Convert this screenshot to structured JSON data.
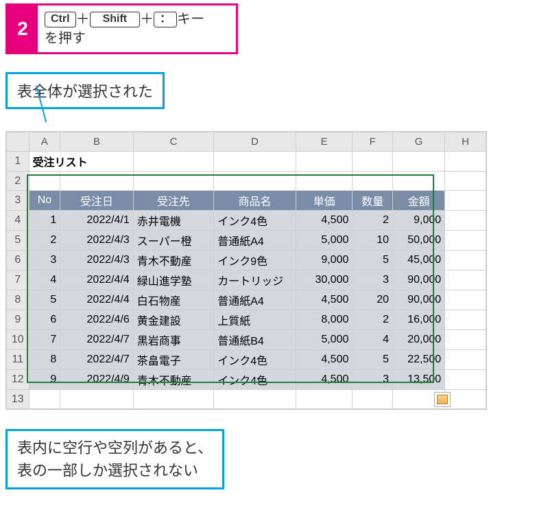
{
  "step": {
    "num": "2",
    "key1": "Ctrl",
    "plus1": "＋",
    "key2": "Shift",
    "plus2": "＋",
    "key3": "：",
    "suffix": "キー",
    "line2": "を押す"
  },
  "callout1": "表全体が選択された",
  "callout2_l1": "表内に空行や空列があると、",
  "callout2_l2": "表の一部しか選択されない",
  "cols": {
    "A": "A",
    "B": "B",
    "C": "C",
    "D": "D",
    "E": "E",
    "F": "F",
    "G": "G",
    "H": "H"
  },
  "rows": {
    "1": "1",
    "2": "2",
    "3": "3",
    "4": "4",
    "5": "5",
    "6": "6",
    "7": "7",
    "8": "8",
    "9": "9",
    "10": "10",
    "11": "11",
    "12": "12",
    "13": "13"
  },
  "title": "受注リスト",
  "headers": {
    "no": "No",
    "date": "受注日",
    "client": "受注先",
    "product": "商品名",
    "price": "単価",
    "qty": "数量",
    "amount": "金額"
  },
  "data": [
    {
      "no": "1",
      "date": "2022/4/1",
      "client": "赤井電機",
      "product": "インク4色",
      "price": "4,500",
      "qty": "2",
      "amount": "9,000"
    },
    {
      "no": "2",
      "date": "2022/4/3",
      "client": "スーパー橙",
      "product": "普通紙A4",
      "price": "5,000",
      "qty": "10",
      "amount": "50,000"
    },
    {
      "no": "3",
      "date": "2022/4/3",
      "client": "青木不動産",
      "product": "インク9色",
      "price": "9,000",
      "qty": "5",
      "amount": "45,000"
    },
    {
      "no": "4",
      "date": "2022/4/4",
      "client": "緑山進学塾",
      "product": "カートリッジ",
      "price": "30,000",
      "qty": "3",
      "amount": "90,000"
    },
    {
      "no": "5",
      "date": "2022/4/4",
      "client": "白石物産",
      "product": "普通紙A4",
      "price": "4,500",
      "qty": "20",
      "amount": "90,000"
    },
    {
      "no": "6",
      "date": "2022/4/6",
      "client": "黄金建設",
      "product": "上質紙",
      "price": "8,000",
      "qty": "2",
      "amount": "16,000"
    },
    {
      "no": "7",
      "date": "2022/4/7",
      "client": "黒岩商事",
      "product": "普通紙B4",
      "price": "5,000",
      "qty": "4",
      "amount": "20,000"
    },
    {
      "no": "8",
      "date": "2022/4/7",
      "client": "茶畠電子",
      "product": "インク4色",
      "price": "4,500",
      "qty": "5",
      "amount": "22,500"
    },
    {
      "no": "9",
      "date": "2022/4/9",
      "client": "青木不動産",
      "product": "インク4色",
      "price": "4,500",
      "qty": "3",
      "amount": "13,500"
    }
  ],
  "chart_data": {
    "type": "table",
    "title": "受注リスト",
    "columns": [
      "No",
      "受注日",
      "受注先",
      "商品名",
      "単価",
      "数量",
      "金額"
    ],
    "rows": [
      [
        1,
        "2022/4/1",
        "赤井電機",
        "インク4色",
        4500,
        2,
        9000
      ],
      [
        2,
        "2022/4/3",
        "スーパー橙",
        "普通紙A4",
        5000,
        10,
        50000
      ],
      [
        3,
        "2022/4/3",
        "青木不動産",
        "インク9色",
        9000,
        5,
        45000
      ],
      [
        4,
        "2022/4/4",
        "緑山進学塾",
        "カートリッジ",
        30000,
        3,
        90000
      ],
      [
        5,
        "2022/4/4",
        "白石物産",
        "普通紙A4",
        4500,
        20,
        90000
      ],
      [
        6,
        "2022/4/6",
        "黄金建設",
        "上質紙",
        8000,
        2,
        16000
      ],
      [
        7,
        "2022/4/7",
        "黒岩商事",
        "普通紙B4",
        5000,
        4,
        20000
      ],
      [
        8,
        "2022/4/7",
        "茶畠電子",
        "インク4色",
        4500,
        5,
        22500
      ],
      [
        9,
        "2022/4/9",
        "青木不動産",
        "インク4色",
        4500,
        3,
        13500
      ]
    ]
  }
}
